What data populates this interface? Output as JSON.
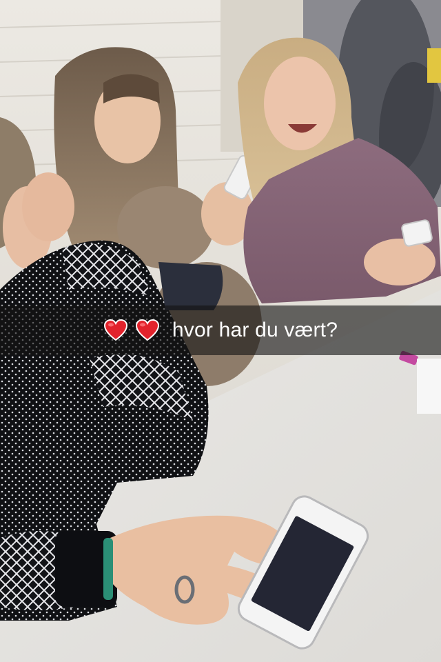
{
  "caption": {
    "text": "hvor har du vært?",
    "emoji": [
      "red-heart-icon",
      "red-heart-icon"
    ],
    "heart_color": "#e2232c",
    "bar_color": "rgba(20,20,20,0.62)",
    "text_color": "#ffffff"
  },
  "photo": {
    "background_wall": "#e9e6df",
    "table": "#eceae6"
  }
}
